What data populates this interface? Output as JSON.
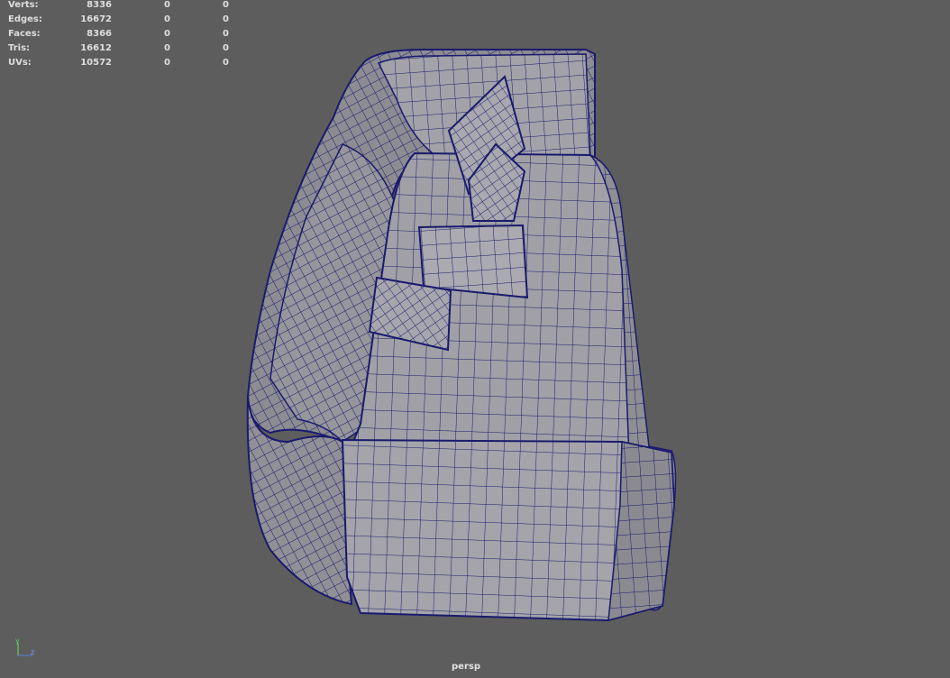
{
  "hud": {
    "rows": [
      {
        "label": "Verts:",
        "v1": "8336",
        "v2": "0",
        "v3": "0"
      },
      {
        "label": "Edges:",
        "v1": "16672",
        "v2": "0",
        "v3": "0"
      },
      {
        "label": "Faces:",
        "v1": "8366",
        "v2": "0",
        "v3": "0"
      },
      {
        "label": "Tris:",
        "v1": "16612",
        "v2": "0",
        "v3": "0"
      },
      {
        "label": "UVs:",
        "v1": "10572",
        "v2": "0",
        "v3": "0"
      }
    ]
  },
  "camera": {
    "name": "persp"
  },
  "axis": {
    "y_label": "y",
    "z_label": "z"
  },
  "colors": {
    "background": "#5d5d5d",
    "mesh_fill": "#9a9a9e",
    "mesh_shadow": "#7a7a80",
    "wire": "#1a1a6e",
    "axis_y": "#5ad25a",
    "axis_z": "#5a7ad2"
  }
}
